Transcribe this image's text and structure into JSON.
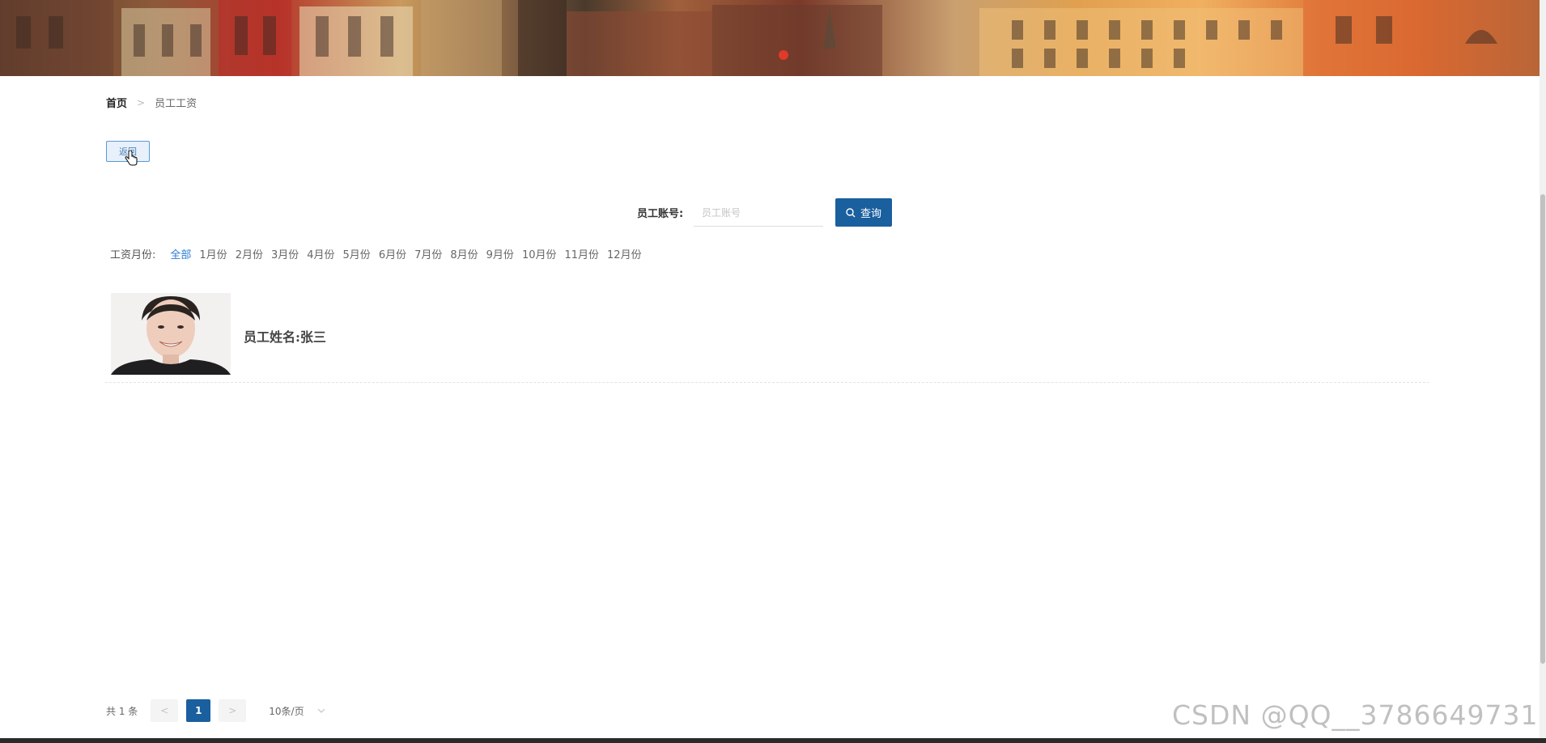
{
  "breadcrumb": {
    "home": "首页",
    "separator": ">",
    "current": "员工工资"
  },
  "back_button": {
    "label": "返回"
  },
  "search": {
    "label": "员工账号:",
    "placeholder": "员工账号",
    "button_label": "查询",
    "button_icon": "search-icon"
  },
  "filter": {
    "label": "工资月份:",
    "options": [
      "全部",
      "1月份",
      "2月份",
      "3月份",
      "4月份",
      "5月份",
      "6月份",
      "7月份",
      "8月份",
      "9月份",
      "10月份",
      "11月份",
      "12月份"
    ],
    "active": "全部"
  },
  "employees": [
    {
      "name_label": "员工姓名:张三"
    }
  ],
  "pagination": {
    "total": "共 1 条",
    "prev": "<",
    "current_page": "1",
    "next": ">",
    "page_size": "10条/页"
  },
  "watermark": "CSDN @QQ__3786649731",
  "colors": {
    "primary": "#1a5f9e",
    "active_link": "#2d7bd6",
    "back_border": "#5a9ad0"
  }
}
